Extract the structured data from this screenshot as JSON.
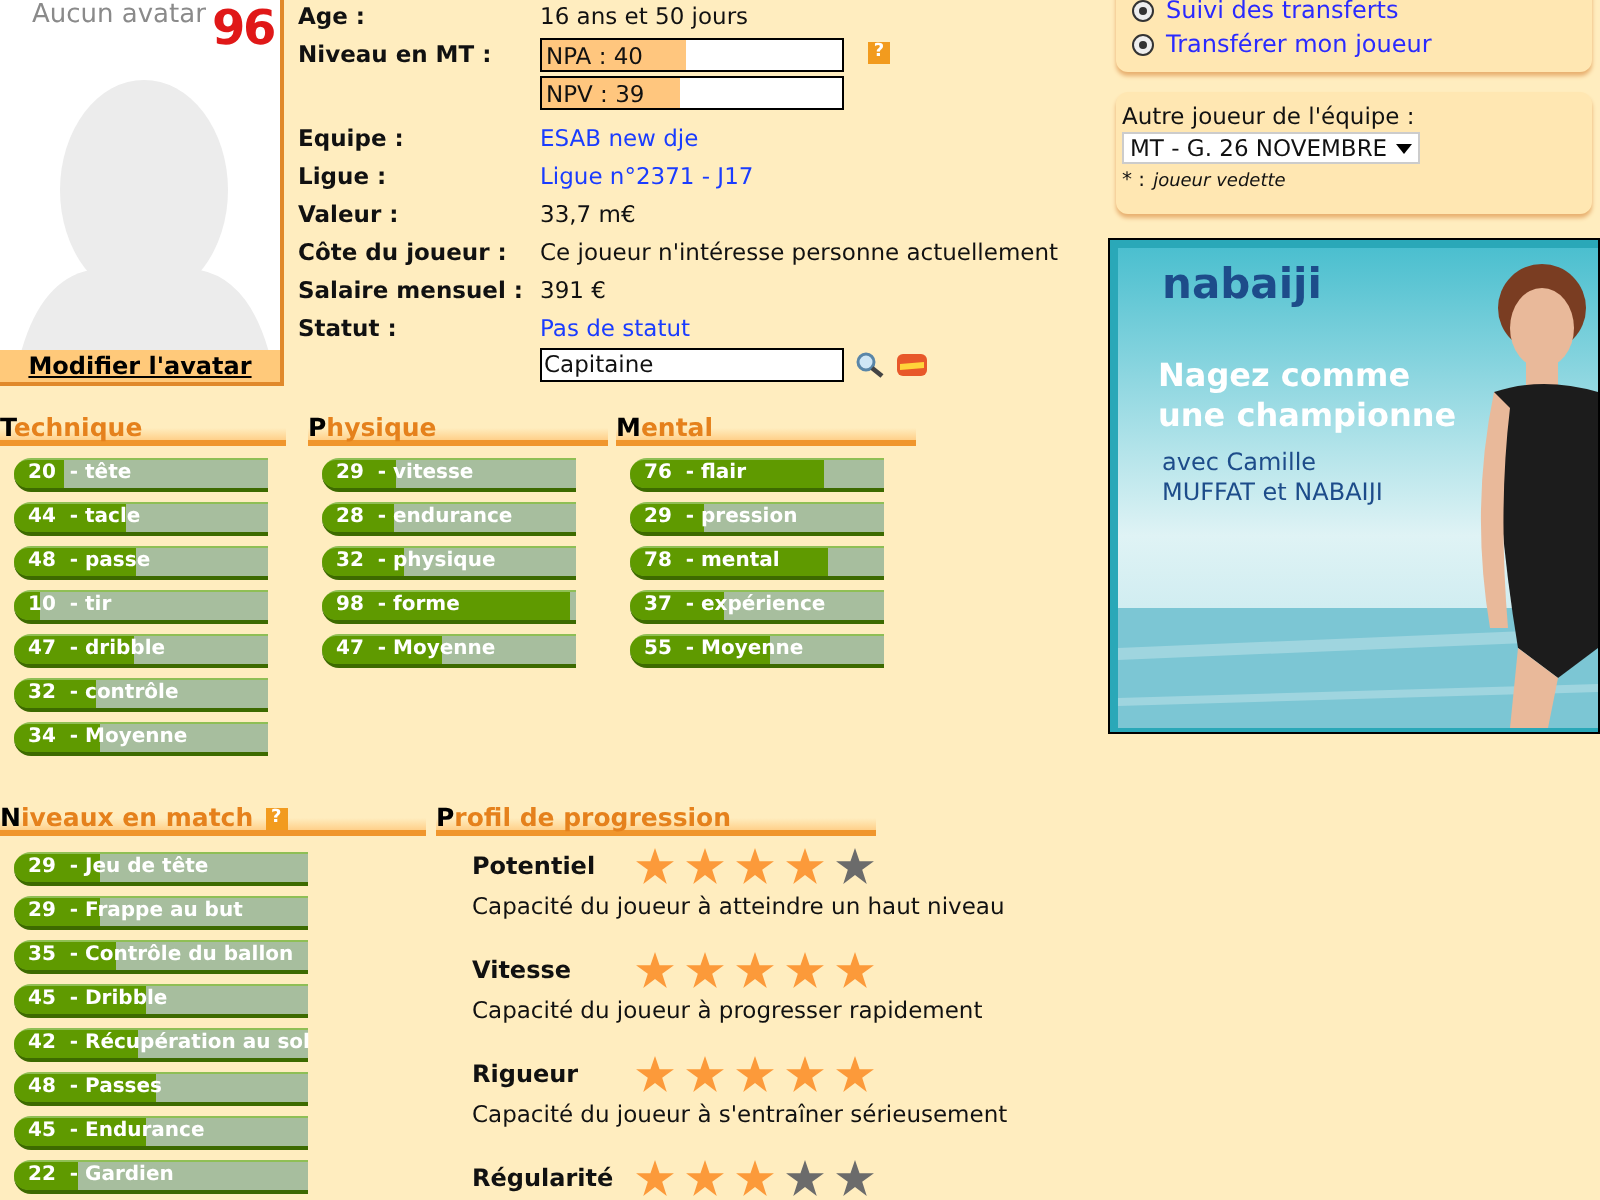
{
  "avatar": {
    "caption": "Aucun avatar",
    "number": "96",
    "link": "Modifier l'avatar"
  },
  "info": [
    {
      "kind": "text",
      "label": "Age :",
      "value": "16 ans et 50 jours"
    },
    {
      "kind": "levels",
      "label": "Niveau en MT :",
      "hint": "?",
      "bars": [
        {
          "text": "NPA : 40",
          "level": 0.48
        },
        {
          "text": "NPV : 39",
          "level": 0.46
        }
      ]
    },
    {
      "kind": "link",
      "label": "Equipe :",
      "value": "ESAB new dje"
    },
    {
      "kind": "link",
      "label": "Ligue :",
      "value": "Ligue n°2371 - J17"
    },
    {
      "kind": "text",
      "label": "Valeur :",
      "value": "33,7 m€"
    },
    {
      "kind": "text",
      "label": "Côte du joueur :",
      "value": "Ce joueur n'intéresse personne actuellement"
    },
    {
      "kind": "text",
      "label": "Salaire mensuel :",
      "value": "391 €"
    },
    {
      "kind": "status",
      "label": "Statut :",
      "value": "Pas de statut",
      "input": "Capitaine"
    }
  ],
  "skills": [
    {
      "title": "Technique",
      "items": [
        {
          "text": "20  - tête",
          "level": 0.2
        },
        {
          "text": "44  - tacle",
          "level": 0.44
        },
        {
          "text": "48  - passe",
          "level": 0.48
        },
        {
          "text": "10  - tir",
          "level": 0.1
        },
        {
          "text": "47  - dribble",
          "level": 0.47
        },
        {
          "text": "32  - contrôle",
          "level": 0.32
        },
        {
          "text": "34  - Moyenne",
          "level": 0.34
        }
      ]
    },
    {
      "title": "Physique",
      "items": [
        {
          "text": "29  - vitesse",
          "level": 0.29
        },
        {
          "text": "28  - endurance",
          "level": 0.28
        },
        {
          "text": "32  - physique",
          "level": 0.32
        },
        {
          "text": "98  - forme",
          "level": 0.98
        },
        {
          "text": "47  - Moyenne",
          "level": 0.47
        }
      ]
    },
    {
      "title": "Mental",
      "items": [
        {
          "text": "76  - flair",
          "level": 0.76
        },
        {
          "text": "29  - pression",
          "level": 0.29
        },
        {
          "text": "78  - mental",
          "level": 0.78
        },
        {
          "text": "37  - expérience",
          "level": 0.37
        },
        {
          "text": "55  - Moyenne",
          "level": 0.55
        }
      ]
    }
  ],
  "match": {
    "title": "Niveaux en match",
    "hint": "?",
    "items": [
      {
        "text": "29  - Jeu de tête",
        "level": 0.29
      },
      {
        "text": "29  - Frappe au but",
        "level": 0.29
      },
      {
        "text": "35  - Contrôle du ballon",
        "level": 0.35
      },
      {
        "text": "45  - Dribble",
        "level": 0.45
      },
      {
        "text": "42  - Récupération au sol",
        "level": 0.42
      },
      {
        "text": "48  - Passes",
        "level": 0.48
      },
      {
        "text": "45  - Endurance",
        "level": 0.45
      },
      {
        "text": "22  - Gardien",
        "level": 0.22
      }
    ]
  },
  "progression": {
    "title": "Profil de progression",
    "items": [
      {
        "name": "Potentiel",
        "stars": 4,
        "description": "Capacité du joueur à atteindre un haut niveau"
      },
      {
        "name": "Vitesse",
        "stars": 5,
        "description": "Capacité du joueur à progresser rapidement"
      },
      {
        "name": "Rigueur",
        "stars": 5,
        "description": "Capacité du joueur à s'entraîner sérieusement"
      },
      {
        "name": "Régularité",
        "stars": 3
      }
    ]
  },
  "sidebar": {
    "links": [
      "Suivi des transferts",
      "Transférer mon joueur"
    ],
    "other_player": {
      "label": "Autre joueur de l'équipe :",
      "select": "MT - G. 26 NOVEMBRE",
      "note_mark": "* :",
      "note": "joueur vedette"
    },
    "ad": {
      "kind": "picture",
      "brand": "nabaiji",
      "headline": "Nagez comme une championne",
      "subline": "avec Camille MUFFAT et NABAIJI"
    }
  }
}
